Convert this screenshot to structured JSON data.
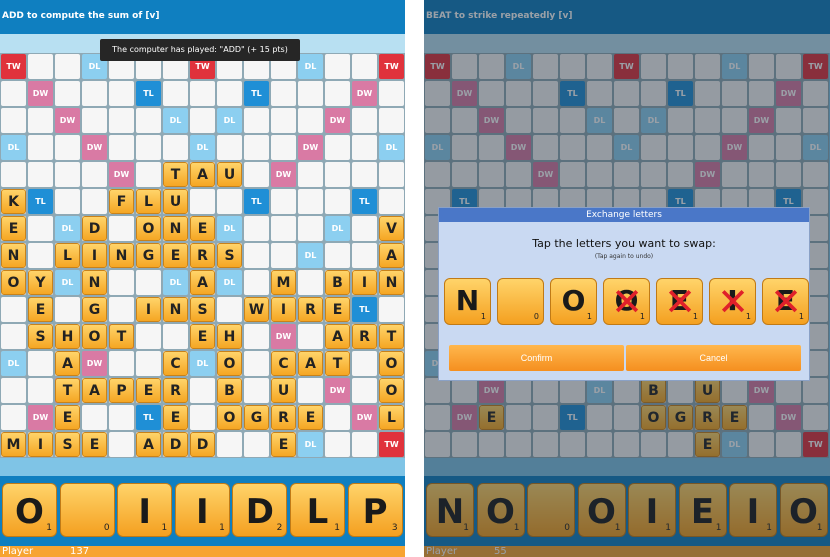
{
  "left": {
    "status": "ADD to compute the sum of [v]",
    "toast": "The computer has played: \"ADD\" (+ 15 pts)",
    "premiums": [
      {
        "r": 0,
        "c": 0,
        "t": "TW"
      },
      {
        "r": 0,
        "c": 3,
        "t": "DL"
      },
      {
        "r": 0,
        "c": 7,
        "t": "TW"
      },
      {
        "r": 0,
        "c": 11,
        "t": "DL"
      },
      {
        "r": 0,
        "c": 14,
        "t": "TW"
      },
      {
        "r": 1,
        "c": 1,
        "t": "DW"
      },
      {
        "r": 1,
        "c": 5,
        "t": "TL"
      },
      {
        "r": 1,
        "c": 9,
        "t": "TL"
      },
      {
        "r": 1,
        "c": 13,
        "t": "DW"
      },
      {
        "r": 2,
        "c": 2,
        "t": "DW"
      },
      {
        "r": 2,
        "c": 6,
        "t": "DL"
      },
      {
        "r": 2,
        "c": 8,
        "t": "DL"
      },
      {
        "r": 2,
        "c": 12,
        "t": "DW"
      },
      {
        "r": 3,
        "c": 0,
        "t": "DL"
      },
      {
        "r": 3,
        "c": 3,
        "t": "DW"
      },
      {
        "r": 3,
        "c": 7,
        "t": "DL"
      },
      {
        "r": 3,
        "c": 11,
        "t": "DW"
      },
      {
        "r": 3,
        "c": 14,
        "t": "DL"
      },
      {
        "r": 4,
        "c": 4,
        "t": "DW"
      },
      {
        "r": 4,
        "c": 10,
        "t": "DW"
      },
      {
        "r": 5,
        "c": 1,
        "t": "TL"
      },
      {
        "r": 5,
        "c": 9,
        "t": "TL"
      },
      {
        "r": 5,
        "c": 13,
        "t": "TL"
      },
      {
        "r": 6,
        "c": 2,
        "t": "DL"
      },
      {
        "r": 6,
        "c": 8,
        "t": "DL"
      },
      {
        "r": 6,
        "c": 12,
        "t": "DL"
      },
      {
        "r": 7,
        "c": 3,
        "t": "DL"
      },
      {
        "r": 7,
        "c": 11,
        "t": "DL"
      },
      {
        "r": 8,
        "c": 2,
        "t": "DL"
      },
      {
        "r": 8,
        "c": 6,
        "t": "DL"
      },
      {
        "r": 8,
        "c": 8,
        "t": "DL"
      },
      {
        "r": 9,
        "c": 1,
        "t": "TL"
      },
      {
        "r": 9,
        "c": 13,
        "t": "TL"
      },
      {
        "r": 10,
        "c": 4,
        "t": "DW"
      },
      {
        "r": 10,
        "c": 10,
        "t": "DW"
      },
      {
        "r": 11,
        "c": 0,
        "t": "DL"
      },
      {
        "r": 11,
        "c": 3,
        "t": "DW"
      },
      {
        "r": 11,
        "c": 7,
        "t": "DL"
      },
      {
        "r": 12,
        "c": 2,
        "t": "DW"
      },
      {
        "r": 12,
        "c": 6,
        "t": "DL"
      },
      {
        "r": 12,
        "c": 12,
        "t": "DW"
      },
      {
        "r": 13,
        "c": 1,
        "t": "DW"
      },
      {
        "r": 13,
        "c": 5,
        "t": "TL"
      },
      {
        "r": 13,
        "c": 13,
        "t": "DW"
      },
      {
        "r": 14,
        "c": 11,
        "t": "DL"
      },
      {
        "r": 14,
        "c": 14,
        "t": "TW"
      }
    ],
    "tiles": [
      {
        "r": 4,
        "c": 6,
        "l": "T"
      },
      {
        "r": 4,
        "c": 7,
        "l": "A"
      },
      {
        "r": 4,
        "c": 8,
        "l": "U"
      },
      {
        "r": 5,
        "c": 0,
        "l": "K"
      },
      {
        "r": 5,
        "c": 4,
        "l": "F"
      },
      {
        "r": 5,
        "c": 5,
        "l": "L"
      },
      {
        "r": 5,
        "c": 6,
        "l": "U"
      },
      {
        "r": 6,
        "c": 0,
        "l": "E"
      },
      {
        "r": 6,
        "c": 3,
        "l": "D"
      },
      {
        "r": 6,
        "c": 5,
        "l": "O"
      },
      {
        "r": 6,
        "c": 6,
        "l": "N"
      },
      {
        "r": 6,
        "c": 7,
        "l": "E"
      },
      {
        "r": 6,
        "c": 14,
        "l": "V"
      },
      {
        "r": 7,
        "c": 0,
        "l": "N"
      },
      {
        "r": 7,
        "c": 2,
        "l": "L"
      },
      {
        "r": 7,
        "c": 3,
        "l": "I"
      },
      {
        "r": 7,
        "c": 4,
        "l": "N"
      },
      {
        "r": 7,
        "c": 5,
        "l": "G"
      },
      {
        "r": 7,
        "c": 6,
        "l": "E"
      },
      {
        "r": 7,
        "c": 7,
        "l": "R"
      },
      {
        "r": 7,
        "c": 8,
        "l": "S"
      },
      {
        "r": 7,
        "c": 14,
        "l": "A"
      },
      {
        "r": 8,
        "c": 0,
        "l": "O"
      },
      {
        "r": 8,
        "c": 1,
        "l": "Y"
      },
      {
        "r": 8,
        "c": 3,
        "l": "N"
      },
      {
        "r": 8,
        "c": 7,
        "l": "A"
      },
      {
        "r": 8,
        "c": 10,
        "l": "M"
      },
      {
        "r": 8,
        "c": 12,
        "l": "B"
      },
      {
        "r": 8,
        "c": 13,
        "l": "I"
      },
      {
        "r": 8,
        "c": 14,
        "l": "N"
      },
      {
        "r": 9,
        "c": 1,
        "l": "E"
      },
      {
        "r": 9,
        "c": 3,
        "l": "G"
      },
      {
        "r": 9,
        "c": 5,
        "l": "I"
      },
      {
        "r": 9,
        "c": 6,
        "l": "N"
      },
      {
        "r": 9,
        "c": 7,
        "l": "S"
      },
      {
        "r": 9,
        "c": 9,
        "l": "W"
      },
      {
        "r": 9,
        "c": 10,
        "l": "I"
      },
      {
        "r": 9,
        "c": 11,
        "l": "R"
      },
      {
        "r": 9,
        "c": 12,
        "l": "E"
      },
      {
        "r": 10,
        "c": 1,
        "l": "S"
      },
      {
        "r": 10,
        "c": 2,
        "l": "H"
      },
      {
        "r": 10,
        "c": 3,
        "l": "O"
      },
      {
        "r": 10,
        "c": 4,
        "l": "T"
      },
      {
        "r": 10,
        "c": 7,
        "l": "E"
      },
      {
        "r": 10,
        "c": 8,
        "l": "H"
      },
      {
        "r": 10,
        "c": 12,
        "l": "A"
      },
      {
        "r": 10,
        "c": 13,
        "l": "R"
      },
      {
        "r": 10,
        "c": 14,
        "l": "T"
      },
      {
        "r": 11,
        "c": 2,
        "l": "A"
      },
      {
        "r": 11,
        "c": 6,
        "l": "C"
      },
      {
        "r": 11,
        "c": 8,
        "l": "O"
      },
      {
        "r": 11,
        "c": 10,
        "l": "C"
      },
      {
        "r": 11,
        "c": 11,
        "l": "A"
      },
      {
        "r": 11,
        "c": 12,
        "l": "T"
      },
      {
        "r": 11,
        "c": 14,
        "l": "O"
      },
      {
        "r": 12,
        "c": 2,
        "l": "T"
      },
      {
        "r": 12,
        "c": 3,
        "l": "A"
      },
      {
        "r": 12,
        "c": 4,
        "l": "P"
      },
      {
        "r": 12,
        "c": 5,
        "l": "E"
      },
      {
        "r": 12,
        "c": 6,
        "l": "R"
      },
      {
        "r": 12,
        "c": 8,
        "l": "B"
      },
      {
        "r": 12,
        "c": 10,
        "l": "U"
      },
      {
        "r": 12,
        "c": 14,
        "l": "O"
      },
      {
        "r": 13,
        "c": 2,
        "l": "E"
      },
      {
        "r": 13,
        "c": 6,
        "l": "E"
      },
      {
        "r": 13,
        "c": 8,
        "l": "O"
      },
      {
        "r": 13,
        "c": 9,
        "l": "G"
      },
      {
        "r": 13,
        "c": 10,
        "l": "R"
      },
      {
        "r": 13,
        "c": 11,
        "l": "E"
      },
      {
        "r": 13,
        "c": 14,
        "l": "L"
      },
      {
        "r": 14,
        "c": 0,
        "l": "M"
      },
      {
        "r": 14,
        "c": 1,
        "l": "I"
      },
      {
        "r": 14,
        "c": 2,
        "l": "S"
      },
      {
        "r": 14,
        "c": 3,
        "l": "E"
      },
      {
        "r": 14,
        "c": 5,
        "l": "A"
      },
      {
        "r": 14,
        "c": 6,
        "l": "D"
      },
      {
        "r": 14,
        "c": 7,
        "l": "D"
      },
      {
        "r": 14,
        "c": 10,
        "l": "E"
      }
    ],
    "rack": [
      {
        "l": "O",
        "p": "1"
      },
      {
        "l": "",
        "p": "0"
      },
      {
        "l": "I",
        "p": "1"
      },
      {
        "l": "I",
        "p": "1"
      },
      {
        "l": "D",
        "p": "2"
      },
      {
        "l": "L",
        "p": "1"
      },
      {
        "l": "P",
        "p": "3"
      }
    ],
    "player_label": "Player",
    "player_score": "137"
  },
  "right": {
    "status": "BEAT to strike repeatedly [v]",
    "board_bottom_tiles": [
      {
        "r": 12,
        "c": 8,
        "l": "B"
      },
      {
        "r": 12,
        "c": 10,
        "l": "U"
      },
      {
        "r": 13,
        "c": 2,
        "l": "E"
      },
      {
        "r": 13,
        "c": 8,
        "l": "O"
      },
      {
        "r": 13,
        "c": 9,
        "l": "G"
      },
      {
        "r": 13,
        "c": 10,
        "l": "R"
      },
      {
        "r": 13,
        "c": 11,
        "l": "E"
      },
      {
        "r": 14,
        "c": 10,
        "l": "E"
      }
    ],
    "rack": [
      {
        "l": "N",
        "p": "1"
      },
      {
        "l": "O",
        "p": "1"
      },
      {
        "l": "",
        "p": "0"
      },
      {
        "l": "O",
        "p": "1"
      },
      {
        "l": "I",
        "p": "1"
      },
      {
        "l": "E",
        "p": "1"
      },
      {
        "l": "I",
        "p": "1"
      },
      {
        "l": "O",
        "p": "1"
      }
    ],
    "player_label": "Player",
    "player_score": "55"
  },
  "dialog": {
    "title": "Exchange letters",
    "instruction": "Tap the letters you want to swap:",
    "subtext": "(Tap again to undo)",
    "tiles": [
      {
        "l": "N",
        "p": "1",
        "x": false
      },
      {
        "l": "",
        "p": "0",
        "x": false
      },
      {
        "l": "O",
        "p": "1",
        "x": false
      },
      {
        "l": "O",
        "p": "1",
        "x": true
      },
      {
        "l": "E",
        "p": "1",
        "x": true
      },
      {
        "l": "I",
        "p": "1",
        "x": true
      },
      {
        "l": "E",
        "p": "1",
        "x": true
      }
    ],
    "confirm_label": "Confirm",
    "cancel_label": "Cancel"
  },
  "colors": {
    "triple_word": "#e0323c",
    "double_word": "#d97aa4",
    "triple_letter": "#1f8fd6",
    "double_letter": "#8ccff0",
    "tile": "#f5a623",
    "header": "#0f7fc0",
    "accent": "#f7a431"
  }
}
